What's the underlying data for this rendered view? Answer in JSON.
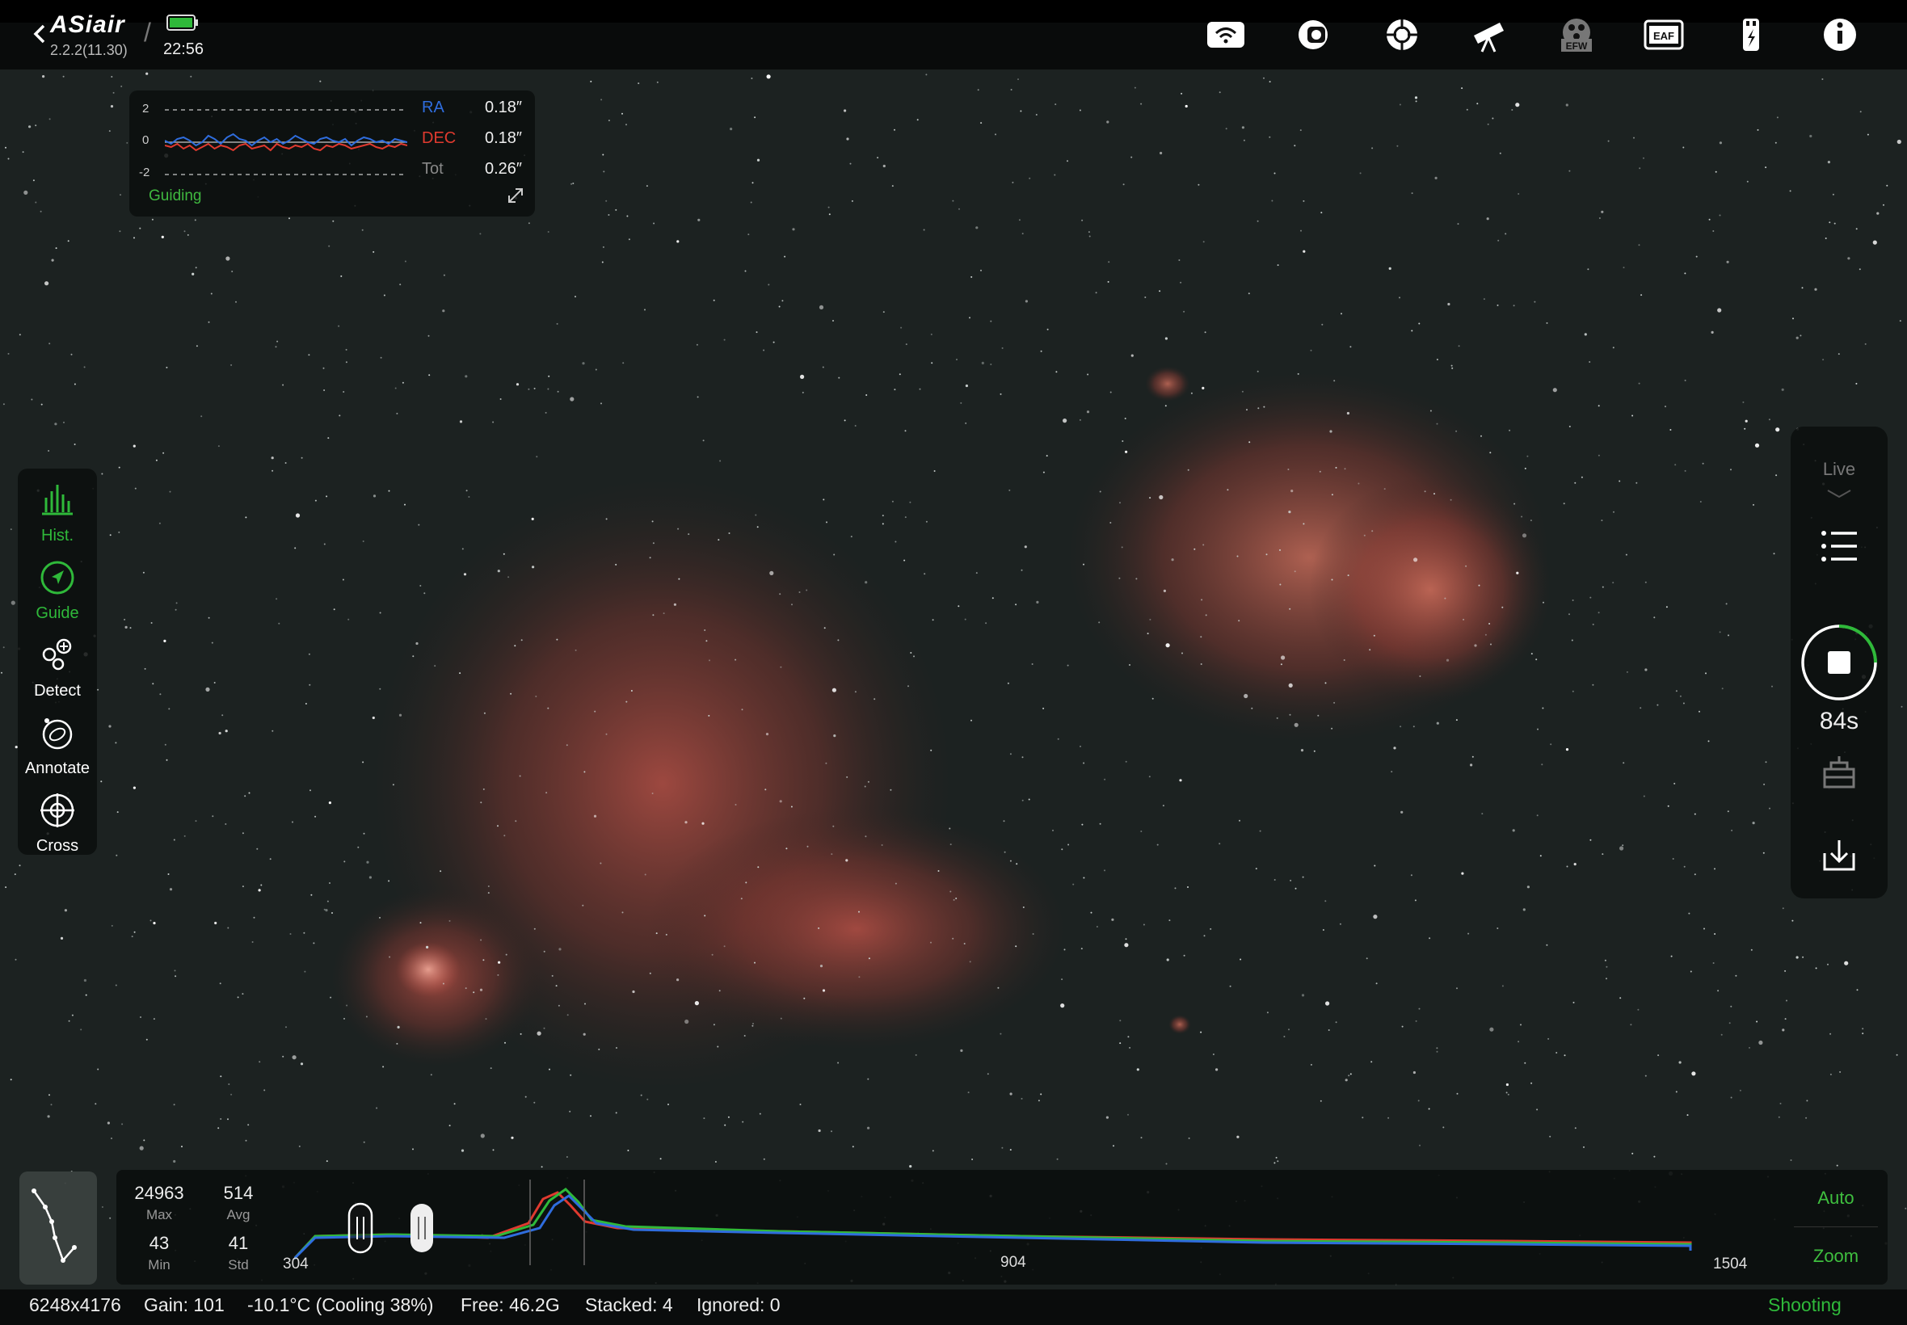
{
  "app": {
    "logo": "ASiair",
    "version": "2.2.2(11.30)",
    "time": "22:56"
  },
  "top_icons": [
    "wifi-icon",
    "camera-icon",
    "guide-scope-icon",
    "telescope-icon",
    "efw-icon",
    "eaf-icon",
    "power-icon",
    "info-icon"
  ],
  "top_labels": {
    "efw": "EFW",
    "eaf": "EAF"
  },
  "guiding": {
    "label": "Guiding",
    "axis": [
      "2",
      "0",
      "-2"
    ],
    "ra_label": "RA",
    "dec_label": "DEC",
    "tot_label": "Tot",
    "ra_value": "0.18″",
    "dec_value": "0.18″",
    "tot_value": "0.26″",
    "ra_series": [
      0.1,
      -0.1,
      0.2,
      0.3,
      0.1,
      -0.2,
      0.0,
      0.4,
      0.2,
      -0.1,
      0.3,
      0.5,
      0.2,
      0.1,
      -0.2,
      0.1,
      0.3,
      0.0,
      0.2,
      -0.1,
      0.1,
      0.4,
      0.2,
      0.0,
      -0.1,
      0.2,
      0.3,
      0.1,
      0.0,
      0.2,
      -0.2,
      0.1,
      0.3,
      0.2,
      0.0,
      0.1,
      -0.1,
      0.2,
      0.1,
      0.0
    ],
    "dec_series": [
      -0.2,
      -0.3,
      -0.1,
      -0.4,
      -0.2,
      -0.5,
      -0.3,
      -0.1,
      -0.4,
      -0.2,
      -0.3,
      -0.5,
      -0.2,
      -0.1,
      -0.4,
      -0.3,
      -0.2,
      -0.5,
      -0.1,
      -0.3,
      -0.4,
      -0.2,
      -0.3,
      -0.1,
      -0.4,
      -0.5,
      -0.2,
      -0.3,
      -0.1,
      -0.2,
      -0.4,
      -0.3,
      -0.2,
      -0.1,
      -0.3,
      -0.4,
      -0.2,
      -0.3,
      -0.1,
      -0.2
    ],
    "colors": {
      "ra": "#2f6dde",
      "dec": "#e03a2f",
      "label": "#3fb83f"
    }
  },
  "left_tools": [
    {
      "label": "Hist.",
      "active": true
    },
    {
      "label": "Guide",
      "active": true
    },
    {
      "label": "Detect",
      "active": false
    },
    {
      "label": "Annotate",
      "active": false
    },
    {
      "label": "Cross",
      "active": false
    }
  ],
  "right_panel": {
    "live_label": "Live",
    "timer": "84s"
  },
  "histogram": {
    "max": "24963",
    "max_label": "Max",
    "avg": "514",
    "avg_label": "Avg",
    "min": "43",
    "min_label": "Min",
    "std": "41",
    "std_label": "Std",
    "x_ticks": [
      "304",
      "904",
      "1504"
    ],
    "auto_label": "Auto",
    "zoom_label": "Zoom",
    "black_point": 0.3,
    "white_point": 0.36
  },
  "status": {
    "resolution": "6248x4176",
    "gain": "Gain: 101",
    "temp": "-10.1°C (Cooling 38%)",
    "free": "Free: 46.2G",
    "stacked": "Stacked: 4",
    "ignored": "Ignored: 0",
    "state": "Shooting"
  },
  "colors": {
    "accent_green": "#2fb93a",
    "background": "#1a1f1e"
  }
}
